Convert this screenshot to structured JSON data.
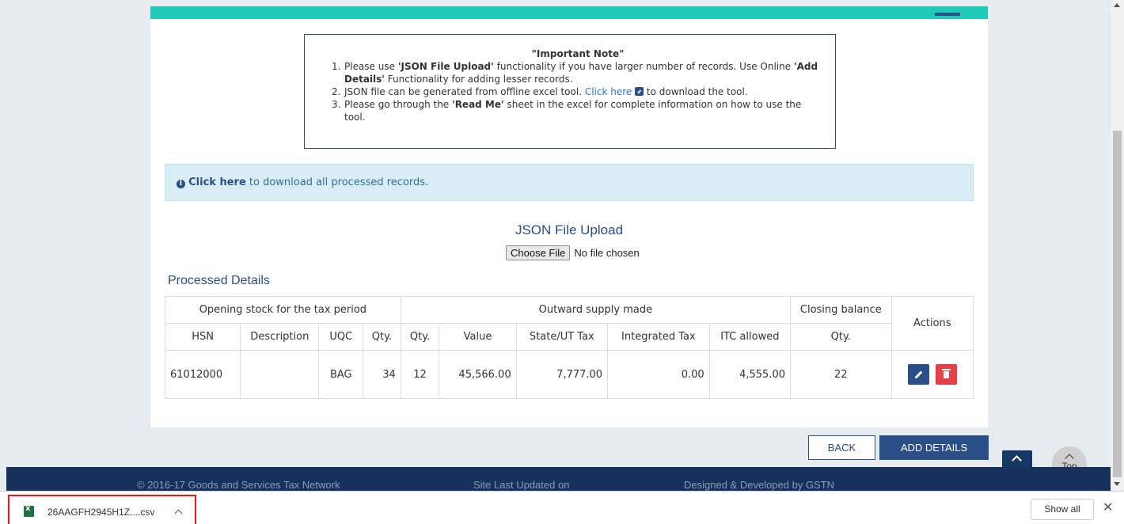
{
  "note": {
    "title": "\"Important Note\"",
    "items": [
      {
        "num": "1.",
        "pre": "Please use ",
        "bold1": "'JSON File Upload'",
        "mid": " functionality if you have larger number of records. Use Online ",
        "bold2": "'Add Details'",
        "post": " Functionality for adding lesser records."
      },
      {
        "num": "2.",
        "pre": "JSON file can be generated from offline excel tool. ",
        "link": "Click here",
        "post": " to download the tool."
      },
      {
        "num": "3.",
        "pre": "Please go through the ",
        "bold1": "'Read Me'",
        "post": " sheet in the excel for complete information on how to use the tool."
      }
    ]
  },
  "info": {
    "link": "Click here",
    "text": " to download all processed records."
  },
  "upload": {
    "title": "JSON File Upload",
    "button": "Choose File",
    "status": "No file chosen"
  },
  "processed": {
    "title": "Processed Details",
    "group_headers": [
      "Opening stock for the tax period",
      "Outward supply made",
      "Closing balance",
      "Actions"
    ],
    "columns": [
      "HSN",
      "Description",
      "UQC",
      "Qty.",
      "Qty.",
      "Value",
      "State/UT Tax",
      "Integrated Tax",
      "ITC allowed",
      "Qty."
    ],
    "rows": [
      {
        "hsn": "61012000",
        "description": "",
        "uqc": "BAG",
        "open_qty": "34",
        "out_qty": "12",
        "value": "45,566.00",
        "state_tax": "7,777.00",
        "integrated_tax": "0.00",
        "itc": "4,555.00",
        "close_qty": "22"
      }
    ]
  },
  "buttons": {
    "back": "BACK",
    "add": "ADD DETAILS",
    "top": "Top"
  },
  "footer": {
    "copyright": "© 2016-17 Goods and Services Tax Network",
    "updated": "Site Last Updated on",
    "designed": "Designed & Developed by GSTN"
  },
  "download_bar": {
    "file_name": "26AAGFH2945H1Z....csv",
    "show_all": "Show all",
    "close": "✕"
  },
  "icons": [
    "external-link-icon",
    "info-icon",
    "pencil-icon",
    "trash-icon",
    "chevron-up-icon",
    "excel-file-icon",
    "close-icon"
  ],
  "colors": {
    "accent": "#2c4e86",
    "teal": "#1fc9b9",
    "danger": "#e53f48",
    "footer": "#17315c",
    "info_bg": "#d9edf7"
  }
}
